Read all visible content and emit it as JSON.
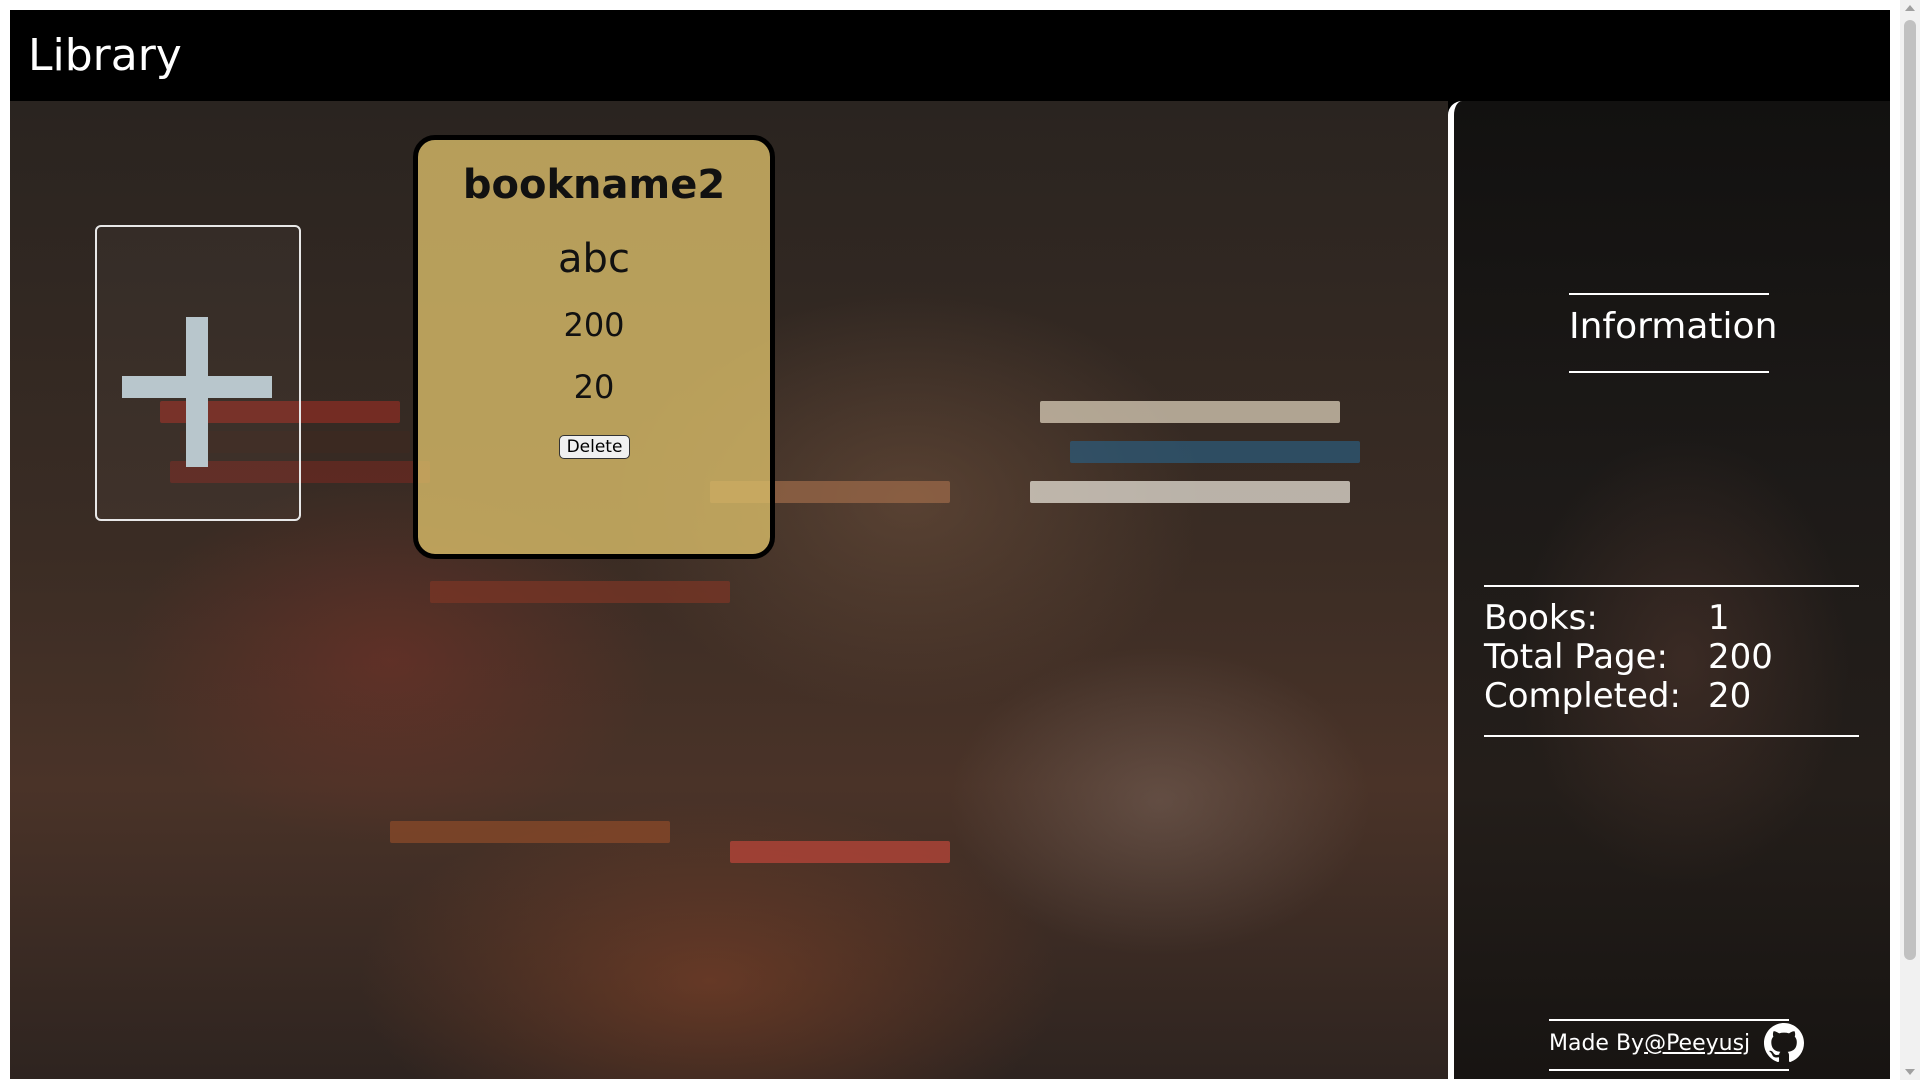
{
  "header": {
    "title": "Library"
  },
  "add_book": {
    "icon": "plus-icon"
  },
  "books": [
    {
      "name": "bookname2",
      "author": "abc",
      "pages": "200",
      "completed": "20",
      "delete_label": "Delete"
    }
  ],
  "sidebar": {
    "title": "Information",
    "stats": {
      "books_label": "Books:",
      "books_value": "1",
      "total_label": "Total Page:",
      "total_value": "200",
      "completed_label": "Completed:",
      "completed_value": "20"
    },
    "footer": {
      "prefix": "Made By",
      "link": "@Peeyusj",
      "icon": "github-icon"
    }
  },
  "colors": {
    "header_bg": "#000000",
    "card_bg": "#d6ba68",
    "plus_color": "#b8c6cc"
  }
}
